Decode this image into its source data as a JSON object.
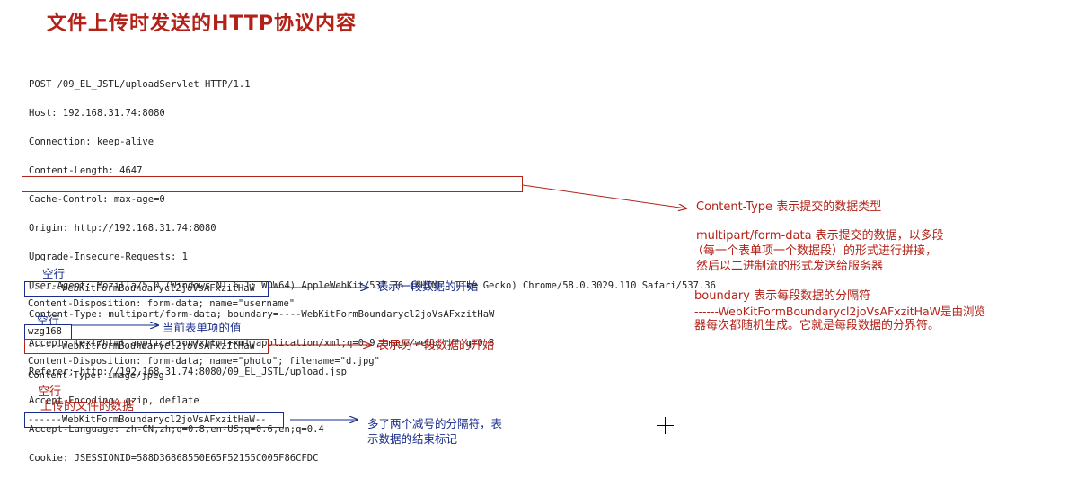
{
  "title": "文件上传时发送的HTTP协议内容",
  "request_lines": [
    "POST /09_EL_JSTL/uploadServlet HTTP/1.1",
    "Host: 192.168.31.74:8080",
    "Connection: keep-alive",
    "Content-Length: 4647",
    "Cache-Control: max-age=0",
    "Origin: http://192.168.31.74:8080",
    "Upgrade-Insecure-Requests: 1",
    "User-Agent: Mozilla/5.0 (Windows NT 6.1; WOW64) AppleWebKit/537.36 (KHTML, like Gecko) Chrome/58.0.3029.110 Safari/537.36",
    "Content-Type: multipart/form-data; boundary=----WebKitFormBoundarycl2joVsAFxzitHaW",
    "Accept: text/html,application/xhtml+xml,application/xml;q=0.9,image/webp,*/*;q=0.8",
    "Referer: http://192.168.31.74:8080/09_EL_JSTL/upload.jsp",
    "Accept-Encoding: gzip, deflate",
    "Accept-Language: zh-CN,zh;q=0.8,en-US;q=0.6,en;q=0.4",
    "Cookie: JSESSIONID=588D36868550E65F52155C005F86CFDC"
  ],
  "body": {
    "empty_line_1": "空行",
    "boundary_1": "------WebKitFormBoundarycl2joVsAFxzitHaW",
    "disposition_1": "Content-Disposition: form-data; name=\"username\"",
    "empty_line_2": "空行",
    "value": "wzg168",
    "boundary_2": "------WebKitFormBoundarycl2joVsAFxzitHaW",
    "disposition_2": "Content-Disposition: form-data; name=\"photo\"; filename=\"d.jpg\"",
    "content_type_2": "Content-Type: image/jpeg",
    "empty_line_3": "空行",
    "file_data": "上传的文件的数据",
    "boundary_end": "------WebKitFormBoundarycl2joVsAFxzitHaW--"
  },
  "annotations": {
    "segment_start": "表示一段数据的开始",
    "form_value": "当前表单项的值",
    "another_segment_start": "表示另一段数据的开始",
    "end_marker_line1": "多了两个减号的分隔符，表",
    "end_marker_line2": "示数据的结束标记",
    "content_type_title": "Content-Type 表示提交的数据类型",
    "multipart_line1": "multipart/form-data 表示提交的数据，以多段",
    "multipart_line2": "（每一个表单项一个数据段）的形式进行拼接，",
    "multipart_line3": "然后以二进制流的形式发送给服务器",
    "boundary_line1": "boundary 表示每段数据的分隔符",
    "boundary_line2": "------WebKitFormBoundarycl2joVsAFxzitHaW是由浏览",
    "boundary_line3": "器每次都随机生成。它就是每段数据的分界符。"
  },
  "colors": {
    "title": "#b32218",
    "red_annotation": "#b32218",
    "blue_annotation": "#1a2d8c",
    "text": "#222222"
  },
  "icons": [
    "crosshair-cursor-icon"
  ]
}
